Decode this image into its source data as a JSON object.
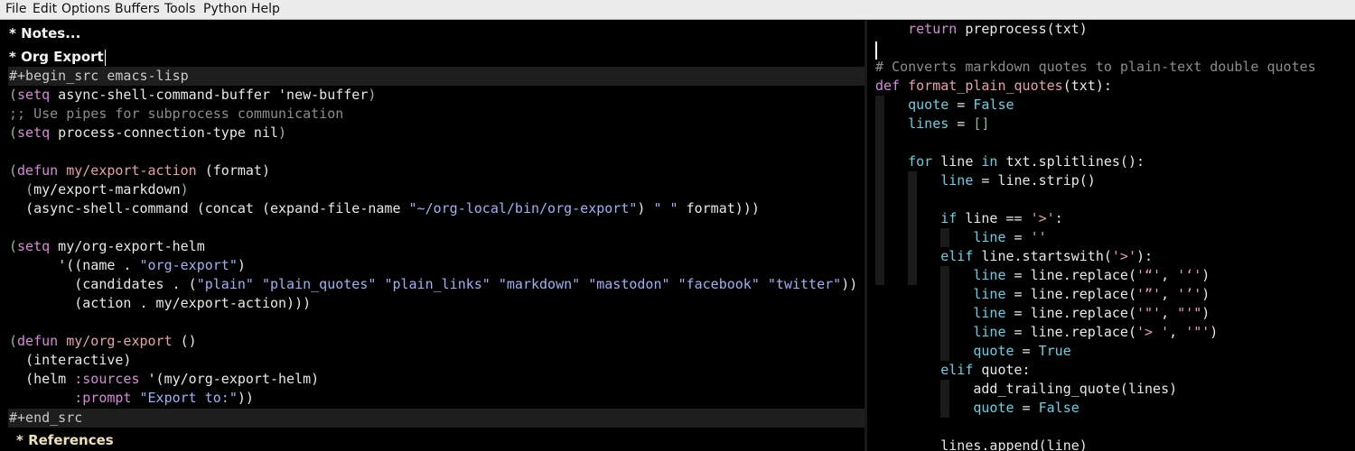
{
  "menubar": {
    "items": [
      "File",
      "Edit",
      "Options",
      "Buffers",
      "Tools",
      "Python",
      "Help"
    ]
  },
  "left": {
    "heading_notes": "* Notes...",
    "heading_export": "* Org Export",
    "begin_src": "#+begin_src emacs-lisp",
    "end_src": "#+end_src",
    "heading_references": "* References",
    "code": {
      "l1": {
        "open": "(",
        "kw": "setq",
        "rest": " async-shell-command-buffer 'new-buffer",
        "close": ")"
      },
      "l2": ";; Use pipes for subprocess communication",
      "l3": {
        "open": "(",
        "kw": "setq",
        "rest": " process-connection-type nil",
        "close": ")"
      },
      "l5": {
        "open": "(",
        "kw": "defun",
        "name": " my/export-action",
        "args": " (format)"
      },
      "l6": {
        "indent": "  ",
        "open": "(",
        "name": "my/export-markdown",
        "close": ")"
      },
      "l7": {
        "indent": "  ",
        "a": "(async-shell-command (concat (expand-file-name ",
        "str": "\"~/org-local/bin/org-export\"",
        "b": ") ",
        "str2": "\" \"",
        "c": " format)))"
      },
      "l9": {
        "open": "(",
        "kw": "setq",
        "rest": " my/org-export-helm"
      },
      "l10": {
        "indent": "      ",
        "a": "'((name . ",
        "str": "\"org-export\"",
        "b": ")"
      },
      "l11": {
        "indent": "        ",
        "a": "(candidates . (",
        "s1": "\"plain\"",
        "s2": "\"plain_quotes\"",
        "s3": "\"plain_links\"",
        "s4": "\"markdown\"",
        "s5": "\"mastodon\"",
        "s6": "\"facebook\"",
        "s7": "\"twitter\"",
        "b": "))"
      },
      "l12": {
        "indent": "        ",
        "a": "(action . my/export-action)))"
      },
      "l14": {
        "open": "(",
        "kw": "defun",
        "name": " my/org-export",
        "args": " ()"
      },
      "l15": {
        "indent": "  ",
        "a": "(interactive)"
      },
      "l16": {
        "indent": "  ",
        "a": "(helm ",
        "kw": ":sources",
        "b": " '(my/org-export-helm)"
      },
      "l17": {
        "indent": "        ",
        "kw": ":prompt",
        "b": " ",
        "str": "\"Export to:\"",
        "c": "))"
      }
    }
  },
  "right": {
    "r0": {
      "indent": "    ",
      "kw": "return",
      "rest": " preprocess(txt)"
    },
    "r2": "# Converts markdown quotes to plain-text double quotes",
    "r3": {
      "kw": "def",
      "name": " format_plain_quotes",
      "rest": "(txt):"
    },
    "r4": {
      "indent": "    ",
      "var": "quote",
      "op": " = ",
      "val": "False"
    },
    "r5": {
      "indent": "    ",
      "var": "lines",
      "op": " = ",
      "val": "[]"
    },
    "r7": {
      "indent": "    ",
      "kw": "for",
      "a": " line ",
      "kw2": "in",
      "b": " txt.splitlines():"
    },
    "r8": {
      "indent": "        ",
      "var": "line",
      "rest": " = line.strip()"
    },
    "r10": {
      "indent": "        ",
      "kw": "if",
      "a": " line == ",
      "str": "'>'",
      "b": ":"
    },
    "r11": {
      "indent": "            ",
      "var": "line",
      "op": " = ",
      "str": "''"
    },
    "r12": {
      "indent": "        ",
      "kw": "elif",
      "a": " line.startswith(",
      "str": "'>'",
      "b": "):"
    },
    "r13": {
      "indent": "            ",
      "var": "line",
      "a": " = line.replace(",
      "s1": "'“'",
      "m": ", ",
      "s2": "'‘'",
      "b": ")"
    },
    "r14": {
      "indent": "            ",
      "var": "line",
      "a": " = line.replace(",
      "s1": "'”'",
      "m": ", ",
      "s2": "'’'",
      "b": ")"
    },
    "r15": {
      "indent": "            ",
      "var": "line",
      "a": " = line.replace(",
      "s1": "'\"'",
      "m": ", ",
      "s2": "\"'\"",
      "b": ")"
    },
    "r16": {
      "indent": "            ",
      "var": "line",
      "a": " = line.replace(",
      "s1": "'> '",
      "m": ", ",
      "s2": "'\"'",
      "b": ")"
    },
    "r17": {
      "indent": "            ",
      "var": "quote",
      "op": " = ",
      "val": "True"
    },
    "r18": {
      "indent": "        ",
      "kw": "elif",
      "a": " quote:"
    },
    "r19": {
      "indent": "            ",
      "a": "add_trailing_quote(lines)"
    },
    "r20": {
      "indent": "            ",
      "var": "quote",
      "op": " = ",
      "val": "False"
    },
    "r22": {
      "indent": "        ",
      "a": "lines.append(line)"
    }
  }
}
